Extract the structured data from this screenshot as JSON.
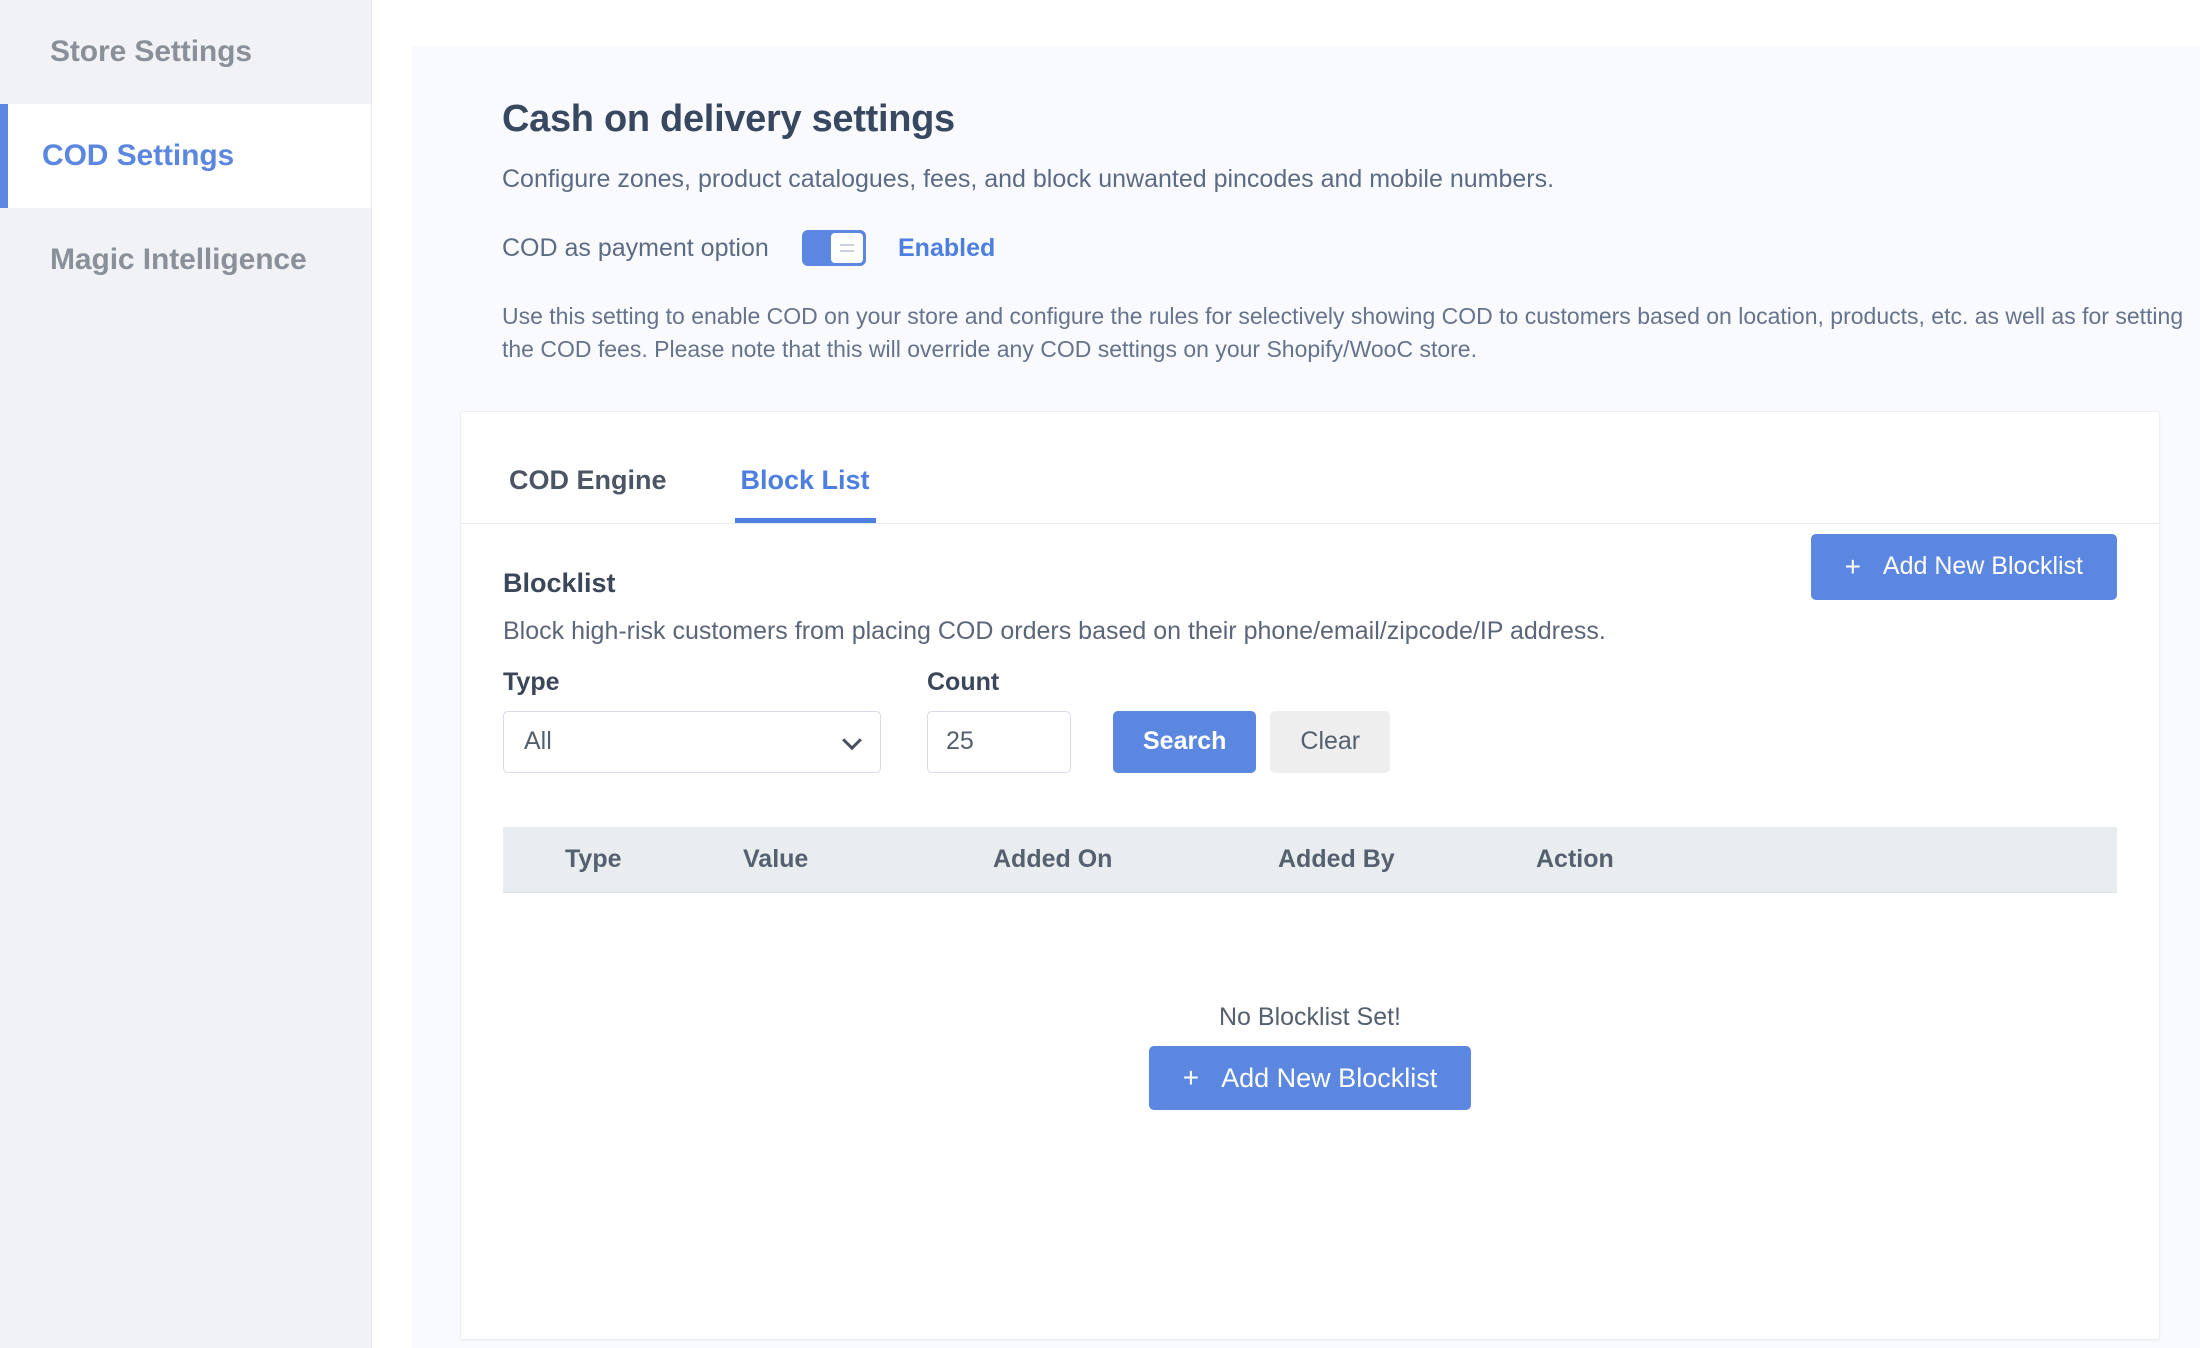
{
  "sidebar": {
    "items": [
      {
        "label": "Store Settings",
        "active": false
      },
      {
        "label": "COD Settings",
        "active": true
      },
      {
        "label": "Magic Intelligence",
        "active": false
      }
    ]
  },
  "page": {
    "title": "Cash on delivery settings",
    "subtitle": "Configure zones, product catalogues, fees, and block unwanted pincodes and mobile numbers.",
    "toggle": {
      "label": "COD as payment option",
      "state": "Enabled",
      "on": true
    },
    "help_text": "Use this setting to enable COD on your store and configure the rules for selectively showing COD to customers based on location, products, etc. as well as for setting the COD fees. Please note that this will override any COD settings on your Shopify/WooC store."
  },
  "tabs": [
    {
      "label": "COD Engine",
      "active": false
    },
    {
      "label": "Block List",
      "active": true
    }
  ],
  "blocklist": {
    "heading": "Blocklist",
    "description": "Block high-risk customers from placing COD orders based on their phone/email/zipcode/IP address.",
    "add_button_label": "Add New Blocklist",
    "plus_icon": "+",
    "filters": {
      "type_label": "Type",
      "type_value": "All",
      "type_options": [
        "All"
      ],
      "count_label": "Count",
      "count_value": "25",
      "search_label": "Search",
      "clear_label": "Clear"
    },
    "table": {
      "columns": [
        "Type",
        "Value",
        "Added On",
        "Added By",
        "Action"
      ]
    },
    "empty": {
      "message": "No Blocklist Set!",
      "button_label": "Add New Blocklist"
    }
  },
  "colors": {
    "accent": "#5b87e0",
    "accent_text": "#4d7fe0",
    "sidebar_bg": "#f1f2f5",
    "page_bg": "#f9fafd",
    "table_header_bg": "#eaedf0"
  }
}
